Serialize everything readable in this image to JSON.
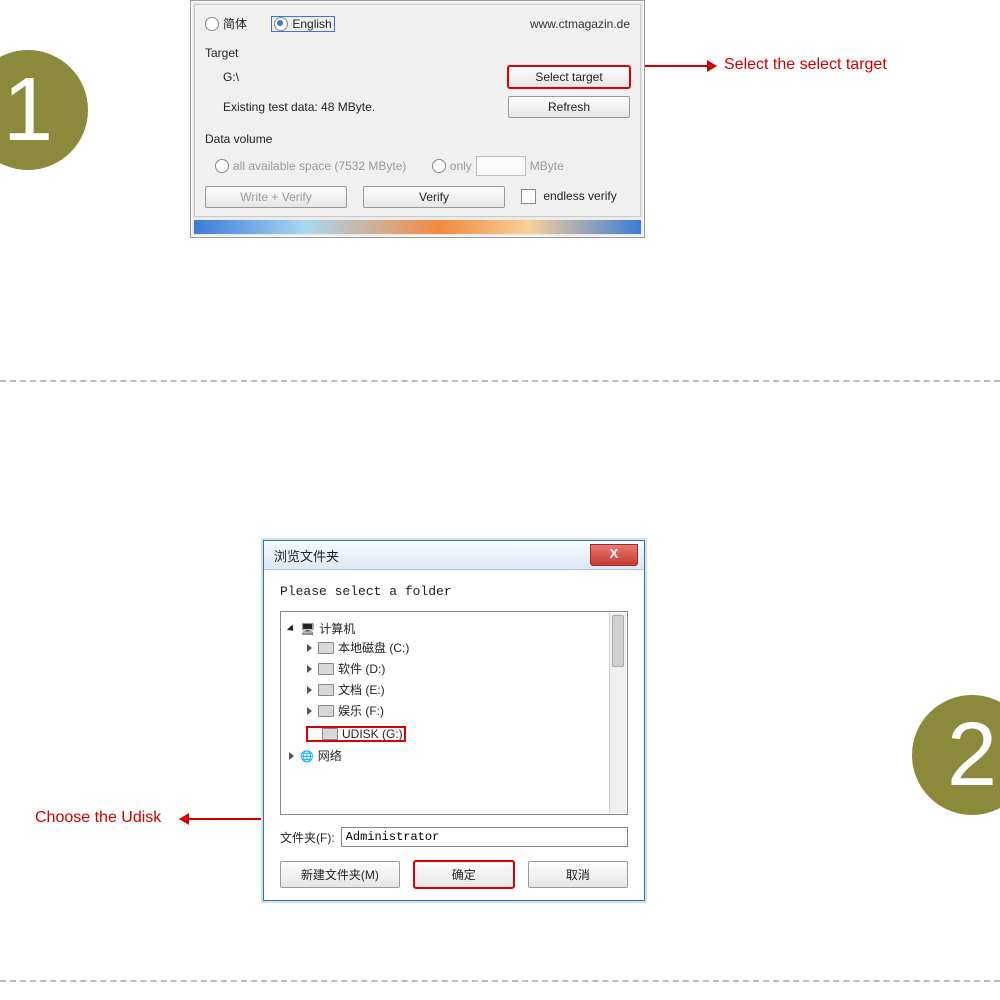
{
  "step1_number": "1",
  "step2_number": "2",
  "annotation1": "Select the select target",
  "annotation2": "Choose the Udisk",
  "win1": {
    "lang_cn": "简体",
    "lang_en": "English",
    "url": "www.ctmagazin.de",
    "target_group": "Target",
    "target_path": "G:\\",
    "select_target_btn": "Select target",
    "existing": "Existing test data: 48 MByte.",
    "refresh_btn": "Refresh",
    "datavol_group": "Data volume",
    "all_space": "all available space (7532 MByte)",
    "only": "only",
    "mbyte_suffix": "MByte",
    "write_verify_btn": "Write + Verify",
    "verify_btn": "Verify",
    "endless_verify": "endless verify"
  },
  "win2": {
    "title": "浏览文件夹",
    "close": "X",
    "instr": "Please select a folder",
    "tree_root": "计算机",
    "drive_c": "本地磁盘 (C:)",
    "drive_d": "软件 (D:)",
    "drive_e": "文档 (E:)",
    "drive_f": "娱乐 (F:)",
    "drive_g": "UDISK (G:)",
    "network": "网络",
    "folder_label": "文件夹(F):",
    "folder_value": "Administrator",
    "new_folder_btn": "新建文件夹(M)",
    "ok_btn": "确定",
    "cancel_btn": "取消"
  }
}
